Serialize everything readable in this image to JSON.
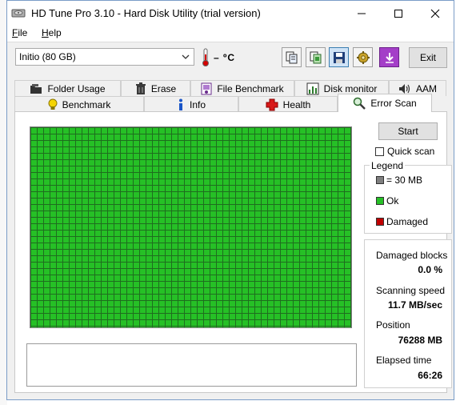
{
  "window": {
    "title": "HD Tune Pro 3.10 - Hard Disk Utility (trial version)",
    "minimize_glyph": "—",
    "maximize_glyph": "☐",
    "close_glyph": "✕"
  },
  "menu": [
    {
      "label": "File",
      "accel": "F"
    },
    {
      "label": "Help",
      "accel": "H"
    }
  ],
  "toolbar": {
    "drive_value": "Initio (80 GB)",
    "temperature": "– ºC",
    "exit_label": "Exit",
    "icons": [
      "copy-info-icon",
      "copy-screenshot-icon",
      "save-icon",
      "options-icon",
      "download-icon"
    ]
  },
  "tabs_top": [
    {
      "label": "Folder Usage",
      "icon": "folder-icon"
    },
    {
      "label": "Erase",
      "icon": "trash-icon"
    },
    {
      "label": "File Benchmark",
      "icon": "file-benchmark-icon"
    },
    {
      "label": "Disk monitor",
      "icon": "disk-monitor-icon"
    },
    {
      "label": "AAM",
      "icon": "speaker-icon"
    }
  ],
  "tabs_bottom": [
    {
      "label": "Benchmark",
      "icon": "lightbulb-icon"
    },
    {
      "label": "Info",
      "icon": "info-icon"
    },
    {
      "label": "Health",
      "icon": "health-cross-icon"
    },
    {
      "label": "Error Scan",
      "icon": "magnifier-icon",
      "active": true
    }
  ],
  "error_scan": {
    "start_label": "Start",
    "quick_scan_label": "Quick scan",
    "quick_scan_checked": false,
    "grid": {
      "columns": 50,
      "rows": 31,
      "ok_color": "#26c026",
      "line_color": "#1f6d1f",
      "damaged_blocks": 0
    },
    "legend": {
      "title": "Legend",
      "items": [
        {
          "label": "= 30 MB",
          "color": "#7f7f7f"
        },
        {
          "label": "Ok",
          "color": "#26c026"
        },
        {
          "label": "Damaged",
          "color": "#c00000"
        }
      ]
    },
    "stats": {
      "damaged_blocks_label": "Damaged blocks",
      "damaged_blocks_value": "0.0 %",
      "scanning_speed_label": "Scanning speed",
      "scanning_speed_value": "11.7 MB/sec",
      "position_label": "Position",
      "position_value": "76288 MB",
      "elapsed_label": "Elapsed time",
      "elapsed_value": "66:26"
    }
  }
}
